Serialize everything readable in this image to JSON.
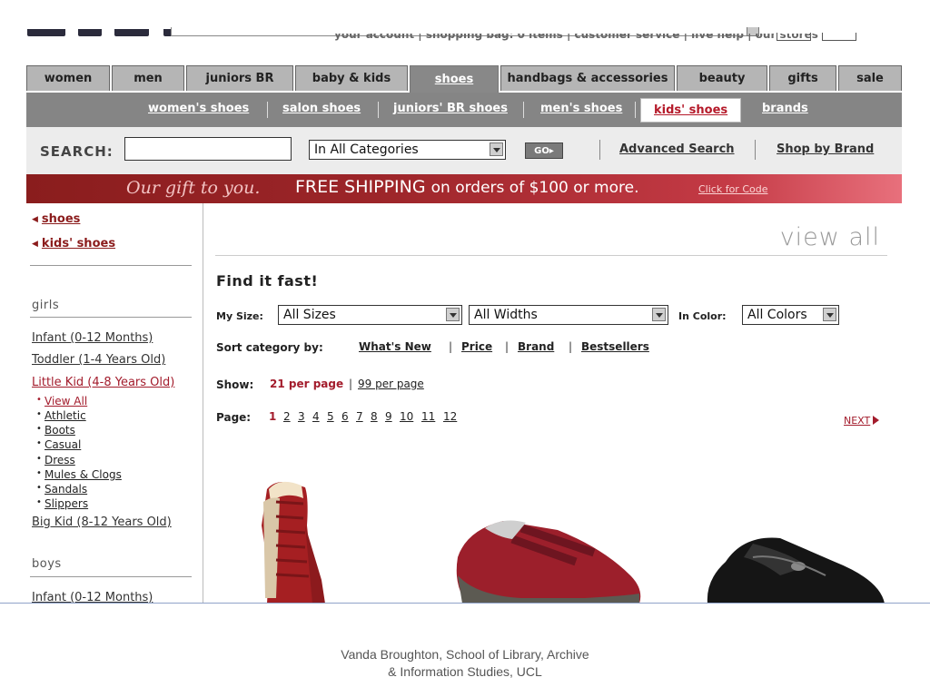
{
  "top": {
    "account_line": "your account | shopping bag: 0 items | customer service | live help | our stores"
  },
  "tabs": [
    {
      "label": "women"
    },
    {
      "label": "men"
    },
    {
      "label": "juniors BR"
    },
    {
      "label": "baby & kids"
    },
    {
      "label": "shoes"
    },
    {
      "label": "handbags & accessories"
    },
    {
      "label": "beauty"
    },
    {
      "label": "gifts"
    },
    {
      "label": "sale"
    }
  ],
  "subnav": [
    {
      "label": "women's shoes"
    },
    {
      "label": "salon shoes"
    },
    {
      "label": "juniors' BR shoes"
    },
    {
      "label": "men's shoes"
    },
    {
      "label": "kids' shoes"
    },
    {
      "label": "brands"
    }
  ],
  "search": {
    "label": "SEARCH:",
    "value": "",
    "category": "In All Categories",
    "go": "GO▸",
    "advanced": "Advanced Search",
    "by_brand": "Shop by Brand"
  },
  "promo": {
    "gift": "Our gift to you.",
    "free": "FREE SHIPPING",
    "rest": "on orders of $100 or more.",
    "code_link": "Click for Code"
  },
  "sidebar": {
    "breadcrumbs": [
      "shoes",
      "kids' shoes"
    ],
    "girls_heading": "girls",
    "girls": [
      {
        "label": "Infant (0-12 Months)"
      },
      {
        "label": "Toddler (1-4 Years Old)"
      },
      {
        "label": "Little Kid (4-8 Years Old)"
      }
    ],
    "subcats": [
      "View All",
      "Athletic",
      "Boots",
      "Casual",
      "Dress",
      "Mules & Clogs",
      "Sandals",
      "Slippers"
    ],
    "big_kid": "Big Kid (8-12 Years Old)",
    "boys_heading": "boys",
    "boys": [
      "Infant (0-12 Months)"
    ]
  },
  "main": {
    "view_all": "view all",
    "find_fast": "Find it fast!",
    "my_size_label": "My Size:",
    "size": "All Sizes",
    "width": "All Widths",
    "color_label": "In Color:",
    "color": "All Colors",
    "sort_label": "Sort category by:",
    "sort_links": [
      "What's New",
      "Price",
      "Brand",
      "Bestsellers"
    ],
    "show_label": "Show:",
    "per_page_current": "21 per page",
    "per_page_other": "99 per page",
    "page_label": "Page:",
    "pages": [
      "1",
      "2",
      "3",
      "4",
      "5",
      "6",
      "7",
      "8",
      "9",
      "10",
      "11",
      "12"
    ],
    "current_page": "1",
    "next": "NEXT"
  },
  "colors": {
    "accent_red": "#a31c2c",
    "tab_grey": "#b5b5b5",
    "subnav_grey": "#858585"
  },
  "footer": {
    "line1": "Vanda Broughton, School of Library, Archive",
    "line2": "& Information Studies, UCL"
  }
}
